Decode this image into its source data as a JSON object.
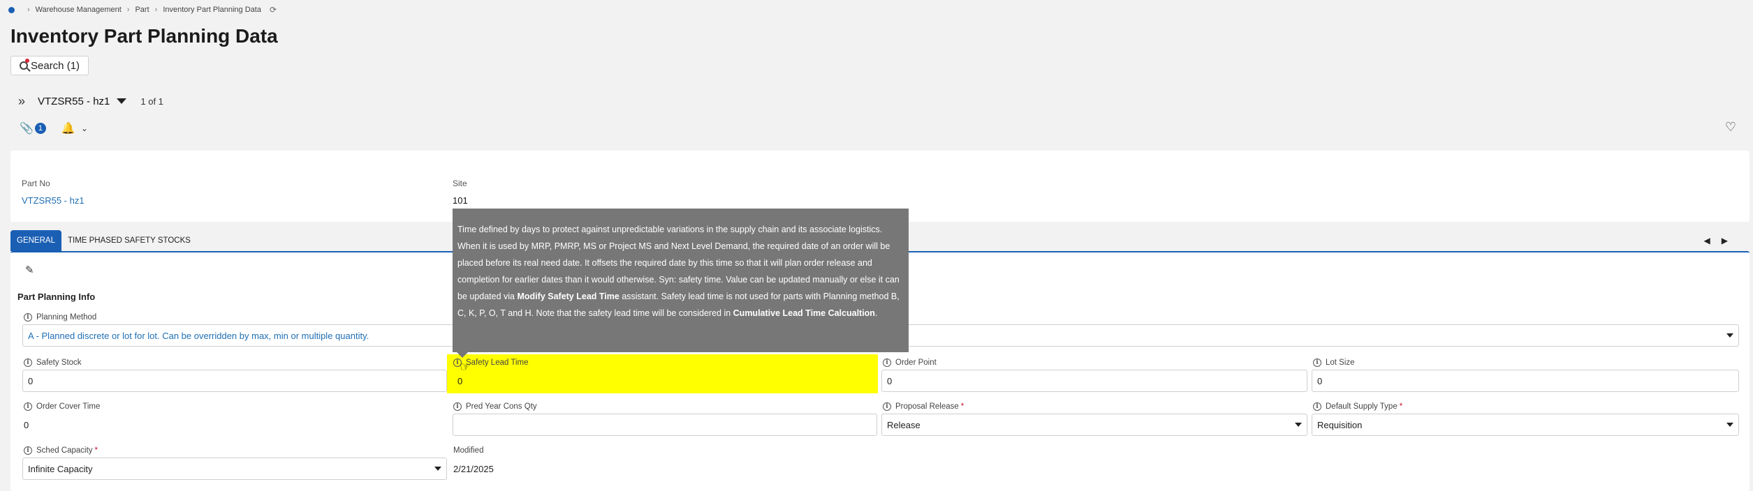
{
  "breadcrumb": [
    "Warehouse Management",
    "Part",
    "Inventory Part Planning Data"
  ],
  "page_title": "Inventory Part Planning Data",
  "search_button": "Search (1)",
  "record_selector": {
    "value": "VTZSR55 - hz1",
    "count": "1 of 1"
  },
  "attachments_count": "1",
  "header": {
    "part_no_label": "Part No",
    "part_no_value": "VTZSR55 - hz1",
    "site_label": "Site",
    "site_value": "101"
  },
  "tabs": [
    {
      "label": "GENERAL",
      "active": true
    },
    {
      "label": "TIME PHASED SAFETY STOCKS",
      "active": false
    }
  ],
  "section_title": "Part Planning Info",
  "fields": {
    "planning_method": {
      "label": "Planning Method",
      "value": "A - Planned discrete or lot for lot. Can be overridden by max, min or multiple quantity."
    },
    "safety_stock": {
      "label": "Safety Stock",
      "value": "0"
    },
    "safety_lead_time": {
      "label": "Safety Lead Time",
      "value": "0"
    },
    "order_point": {
      "label": "Order Point",
      "value": "0"
    },
    "lot_size": {
      "label": "Lot Size",
      "value": "0"
    },
    "order_cover_time": {
      "label": "Order Cover Time",
      "value": "0"
    },
    "pred_year_cons_qty": {
      "label": "Pred Year Cons Qty",
      "value": ""
    },
    "proposal_release": {
      "label": "Proposal Release",
      "value": "Release",
      "required": "*"
    },
    "default_supply_type": {
      "label": "Default Supply Type",
      "value": "Requisition",
      "required": "*"
    },
    "sched_capacity": {
      "label": "Sched Capacity",
      "value": "Infinite Capacity",
      "required": "*"
    },
    "modified": {
      "label": "Modified",
      "value": "2/21/2025"
    }
  },
  "tooltip": {
    "part1": "Time defined by days to protect against unpredictable variations in the supply chain and its associate logistics. When it is used by MRP, PMRP, MS or Project MS and Next Level Demand, the required date of an order will be placed before its real need date. It offsets the required date by this time so that it will plan order release and completion for earlier dates than it would otherwise. Syn: safety time. Value can be updated manually or else it can be updated via ",
    "bold1": "Modify Safety Lead Time",
    "part2": " assistant. Safety lead time is not used for parts with Planning method B, C, K, P, O, T and H. Note that the safety lead time will be considered in ",
    "bold2": "Cumulative Lead Time Calcualtion",
    "part3": "."
  },
  "colors": {
    "accent": "#1a5fb4",
    "highlight": "#ffff00",
    "tooltip_bg": "#777777",
    "link": "#1f6fb5",
    "required": "#c8102e"
  },
  "icons": [
    "home-icon",
    "refresh-icon",
    "search-icon",
    "expand-icon",
    "paperclip-icon",
    "bell-icon",
    "heart-icon",
    "edit-icon",
    "info-icon",
    "chevron-left-icon",
    "chevron-right-icon"
  ]
}
